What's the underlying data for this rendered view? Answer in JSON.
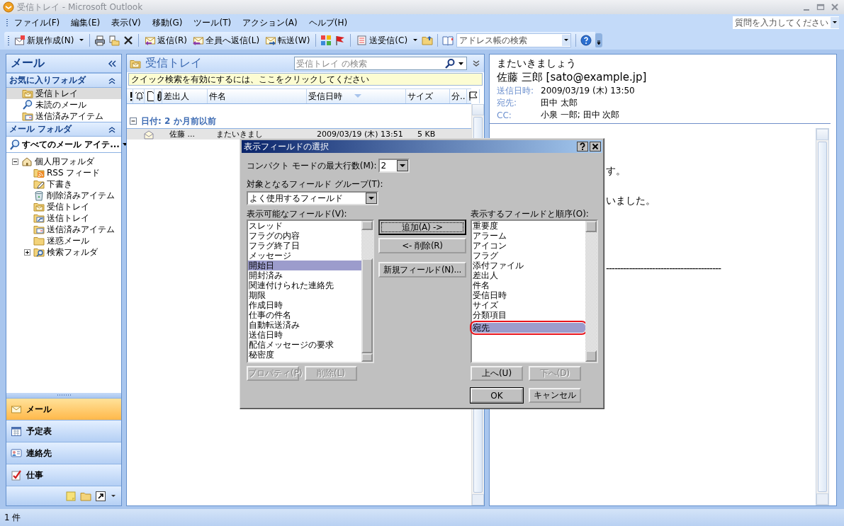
{
  "window": {
    "title": "受信トレイ - Microsoft Outlook"
  },
  "menu": [
    "ファイル(F)",
    "編集(E)",
    "表示(V)",
    "移動(G)",
    "ツール(T)",
    "アクション(A)",
    "ヘルプ(H)"
  ],
  "help_search": {
    "placeholder": "質問を入力してください"
  },
  "toolbar": {
    "new": "新規作成(N)",
    "reply": "返信(R)",
    "reply_all": "全員へ返信(L)",
    "forward": "転送(W)",
    "send_receive": "送受信(C)",
    "address_search": {
      "placeholder": "アドレス帳の検索"
    }
  },
  "navigation": {
    "title": "メール",
    "favorites": {
      "title": "お気に入りフォルダ",
      "expanded": true,
      "items": [
        {
          "label": "受信トレイ",
          "selected": true
        },
        {
          "label": "未読のメール",
          "selected": false
        },
        {
          "label": "送信済みアイテム",
          "selected": false
        }
      ]
    },
    "mail_folders": {
      "title": "メール フォルダ",
      "expanded": true,
      "view": "すべてのメール アイテ...",
      "tree": [
        {
          "label": "個人用フォルダ",
          "expanded": true,
          "children": [
            {
              "label": "RSS フィード"
            },
            {
              "label": "下書き"
            },
            {
              "label": "削除済みアイテム"
            },
            {
              "label": "受信トレイ"
            },
            {
              "label": "送信トレイ"
            },
            {
              "label": "送信済みアイテム"
            },
            {
              "label": "迷惑メール"
            },
            {
              "label": "検索フォルダ",
              "expanded": false
            }
          ]
        }
      ]
    },
    "buttons": [
      {
        "label": "メール",
        "selected": true
      },
      {
        "label": "予定表",
        "selected": false
      },
      {
        "label": "連絡先",
        "selected": false
      },
      {
        "label": "仕事",
        "selected": false
      }
    ]
  },
  "message_list": {
    "title": "受信トレイ",
    "search": {
      "placeholder": "受信トレイ の検索"
    },
    "quick_search_notice": "クイック検索を有効にするには、ここをクリックしてください",
    "columns": [
      {
        "kind": "icon",
        "sorted": false
      },
      {
        "kind": "icon",
        "sorted": false
      },
      {
        "kind": "icon",
        "sorted": false
      },
      {
        "kind": "icon",
        "sorted": false
      },
      {
        "kind": "text",
        "label": "差出人",
        "sorted": false
      },
      {
        "kind": "text",
        "label": "件名",
        "sorted": false
      },
      {
        "kind": "text",
        "label": "受信日時",
        "sorted": true
      },
      {
        "kind": "text",
        "label": "サイズ",
        "sorted": false
      },
      {
        "kind": "text",
        "label": "分...",
        "sorted": false
      },
      {
        "kind": "icon",
        "sorted": false
      }
    ],
    "groups": [
      {
        "label": "日付: 2 か月前以前",
        "expanded": true,
        "rows": [
          {
            "from": "佐藤 ...",
            "subject": "またいきまし",
            "received": "2009/03/19 (木) 13:51",
            "size": "5 KB",
            "read": true,
            "selected": true
          }
        ]
      }
    ]
  },
  "reading_pane": {
    "subject": "またいきましょう",
    "sender": "佐藤 三郎 [sato@example.jp]",
    "fields": [
      {
        "label": "送信日時:",
        "value": "2009/03/19 (木) 13:50"
      },
      {
        "label": "宛先:",
        "value": "田中 太郎"
      },
      {
        "label": "CC:",
        "value": "小泉 一郎; 田中 次郎"
      }
    ],
    "body_lines": [
      "す。",
      "いました。",
      "----------------------------------------"
    ]
  },
  "dialog": {
    "title": "表示フィールドの選択",
    "max_rows_label": "コンパクト モードの最大行数(M):",
    "max_rows_value": "2",
    "field_group_label": "対象となるフィールド グループ(T):",
    "field_group_value": "よく使用するフィールド",
    "available_label": "表示可能なフィールド(V):",
    "available": [
      {
        "label": "スレッド",
        "selected": false
      },
      {
        "label": "フラグの内容",
        "selected": false
      },
      {
        "label": "フラグ終了日",
        "selected": false
      },
      {
        "label": "メッセージ",
        "selected": false
      },
      {
        "label": "開始日",
        "selected": true
      },
      {
        "label": "開封済み",
        "selected": false
      },
      {
        "label": "関連付けられた連絡先",
        "selected": false
      },
      {
        "label": "期限",
        "selected": false
      },
      {
        "label": "作成日時",
        "selected": false
      },
      {
        "label": "仕事の件名",
        "selected": false
      },
      {
        "label": "自動転送済み",
        "selected": false
      },
      {
        "label": "送信日時",
        "selected": false
      },
      {
        "label": "配信メッセージの要求",
        "selected": false
      },
      {
        "label": "秘密度",
        "selected": false
      }
    ],
    "add_button": {
      "label": "追加(A) ->",
      "disabled": false,
      "focused": true
    },
    "remove_button": {
      "label": "<- 削除(R)",
      "disabled": false,
      "focused": false
    },
    "new_field_button": {
      "label": "新規フィールド(N)...",
      "disabled": false,
      "focused": false
    },
    "properties_button": {
      "label": "プロパティ(P)",
      "disabled": true
    },
    "delete_button": {
      "label": "削除(L)",
      "disabled": true
    },
    "shown_label": "表示するフィールドと順序(O):",
    "shown": [
      {
        "label": "重要度",
        "selected": false,
        "circled": false
      },
      {
        "label": "アラーム",
        "selected": false,
        "circled": false
      },
      {
        "label": "アイコン",
        "selected": false,
        "circled": false
      },
      {
        "label": "フラグ",
        "selected": false,
        "circled": false
      },
      {
        "label": "添付ファイル",
        "selected": false,
        "circled": false
      },
      {
        "label": "差出人",
        "selected": false,
        "circled": false
      },
      {
        "label": "件名",
        "selected": false,
        "circled": false
      },
      {
        "label": "受信日時",
        "selected": false,
        "circled": false
      },
      {
        "label": "サイズ",
        "selected": false,
        "circled": false
      },
      {
        "label": "分類項目",
        "selected": false,
        "circled": false
      },
      {
        "label": "宛先",
        "selected": true,
        "circled": true
      }
    ],
    "up_button": {
      "label": "上へ(U)",
      "disabled": false
    },
    "down_button": {
      "label": "下へ(D)",
      "disabled": true
    },
    "ok_button": {
      "label": "OK",
      "default": true
    },
    "cancel_button": {
      "label": "キャンセル",
      "default": false
    }
  },
  "status_bar": {
    "text": "1 件"
  }
}
